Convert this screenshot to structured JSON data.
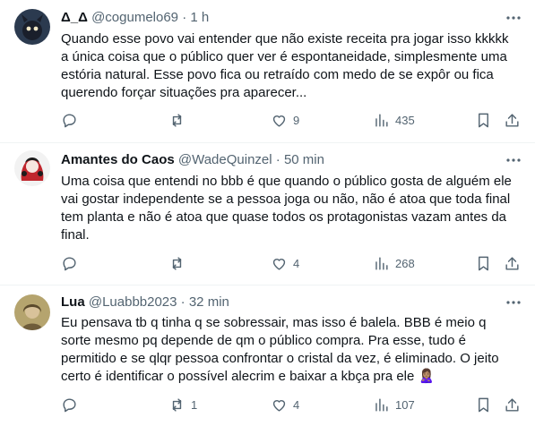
{
  "tweets": [
    {
      "name": "Δ_Δ",
      "handle": "@cogumelo69",
      "dot": "·",
      "time": "1 h",
      "lines": [
        "Quando esse povo vai entender que não existe receita pra jogar isso kkkkk",
        "a única coisa que o público quer ver é espontaneidade, simplesmente uma",
        "estória natural. Esse povo fica ou retraído com medo de se expôr ou fica",
        "querendo forçar situações pra aparecer..."
      ],
      "replies": "",
      "retweets": "",
      "likes": "9",
      "views": "435",
      "avatar_colors": [
        "#2b3a4f",
        "#1a1f2b"
      ]
    },
    {
      "name": "Amantes do Caos",
      "handle": "@WadeQuinzel",
      "dot": "·",
      "time": "50 min",
      "lines": [
        "Uma coisa que entendi no bbb é que quando o público gosta de alguém ele",
        "vai gostar independente se a pessoa joga ou não, não é atoa que toda final",
        "tem planta e não é atoa que quase todos os protagonistas vazam antes da",
        "final."
      ],
      "replies": "",
      "retweets": "",
      "likes": "4",
      "views": "268",
      "avatar_colors": [
        "#f2f2f2",
        "#c0262d"
      ]
    },
    {
      "name": "Lua",
      "handle": "@Luabbb2023",
      "dot": "·",
      "time": "32 min",
      "lines": [
        "Eu pensava tb q tinha q se sobressair, mas isso é balela. BBB é meio q",
        "sorte mesmo pq depende de qm o público compra. Pra esse, tudo é",
        "permitido e se qlqr pessoa confrontar o cristal da vez, é eliminado. O jeito",
        "certo é identificar o possível alecrim e baixar a kbça pra ele 🙎🏽‍♀️"
      ],
      "replies": "",
      "retweets": "1",
      "likes": "4",
      "views": "107",
      "avatar_colors": [
        "#b5a46e",
        "#5b4a2c"
      ]
    }
  ]
}
